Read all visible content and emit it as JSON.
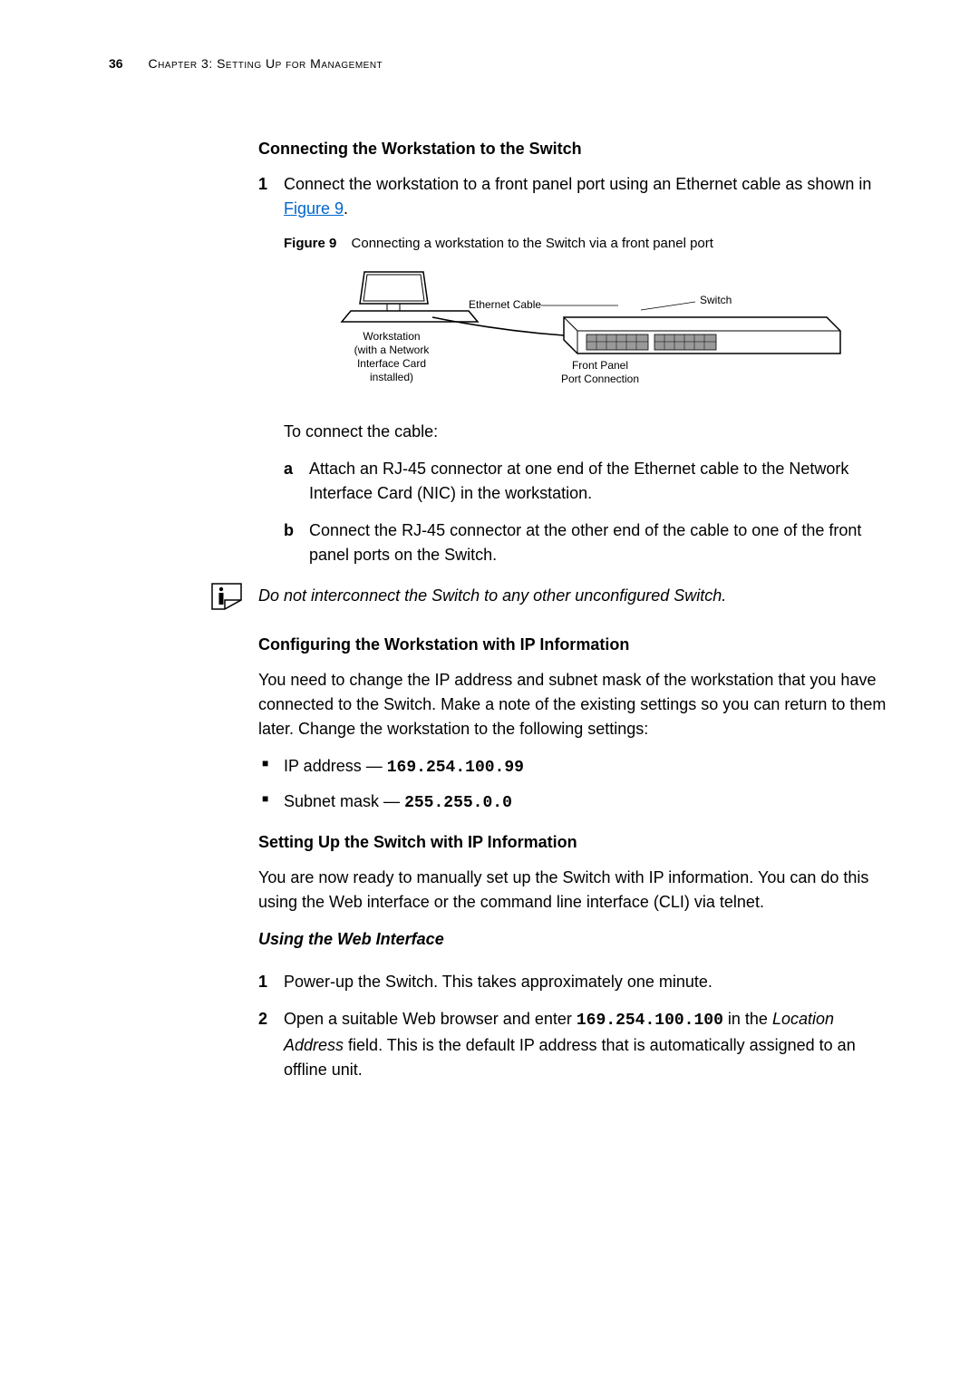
{
  "header": {
    "page_num": "36",
    "chapter": "Chapter 3: Setting Up for Management"
  },
  "section1": {
    "heading": "Connecting the Workstation to the Switch",
    "step1_num": "1",
    "step1_text_a": "Connect the workstation to a front panel port using an Ethernet cable as shown in ",
    "step1_link": "Figure 9",
    "step1_text_b": ".",
    "figure_label": "Figure 9",
    "figure_caption": "Connecting a workstation to the Switch via a front panel port",
    "diagram": {
      "ethernet_cable": "Ethernet Cable",
      "switch": "Switch",
      "workstation": "Workstation",
      "workstation_sub1": "(with a Network",
      "workstation_sub2": "Interface Card",
      "workstation_sub3": "installed)",
      "front_panel": "Front Panel",
      "port_connection": "Port Connection"
    },
    "connect_intro": "To connect the cable:",
    "sub_a": "a",
    "sub_a_text": "Attach an RJ-45 connector at one end of the Ethernet cable to the Network Interface Card (NIC) in the workstation.",
    "sub_b": "b",
    "sub_b_text": "Connect the RJ-45 connector at the other end of the cable to one of the front panel ports on the Switch."
  },
  "note": "Do not interconnect the Switch to any other unconfigured Switch.",
  "section2": {
    "heading": "Configuring the Workstation with IP Information",
    "para": "You need to change the IP address and subnet mask of the workstation that you have connected to the Switch. Make a note of the existing settings so you can return to them later. Change the workstation to the following settings:",
    "bullet1_label": "IP address — ",
    "bullet1_value": "169.254.100.99",
    "bullet2_label": "Subnet mask — ",
    "bullet2_value": "255.255.0.0"
  },
  "section3": {
    "heading": "Setting Up the Switch with IP Information",
    "para": "You are now ready to manually set up the Switch with IP information. You can do this using the Web interface or the command line interface (CLI) via telnet."
  },
  "section4": {
    "heading": "Using the Web Interface",
    "step1_num": "1",
    "step1_text": "Power-up the Switch. This takes approximately one minute.",
    "step2_num": "2",
    "step2_text_a": "Open a suitable Web browser and enter ",
    "step2_value": "169.254.100.100",
    "step2_text_b": " in the ",
    "step2_italic": "Location Address",
    "step2_text_c": " field. This is the default IP address that is automatically assigned to an offline unit."
  }
}
